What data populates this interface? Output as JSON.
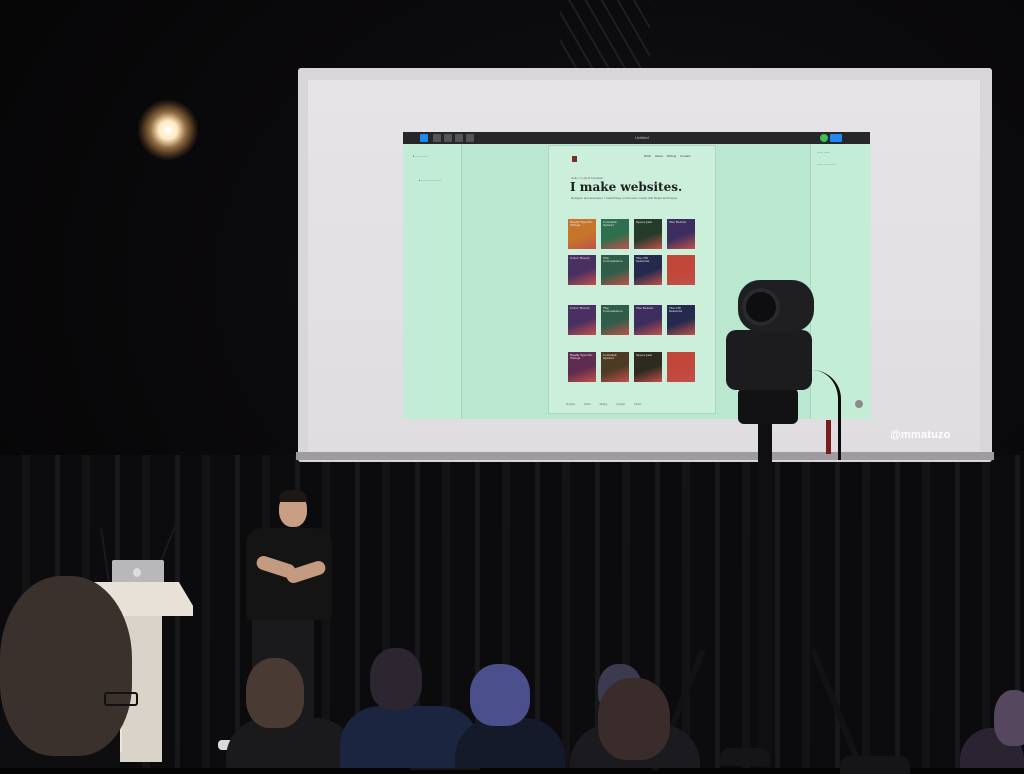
{
  "projected_app": {
    "window_title": "Untitled"
  },
  "projected_site": {
    "eyebrow": "Hello, I'm Emil Kowalski",
    "headline": "I make websites.",
    "intro": "Designer and developer. I build things on the web, mostly with React and Figma.",
    "nav": [
      "Work",
      "About",
      "Writing",
      "Contact"
    ],
    "cards": [
      {
        "title": "Really Specific Things",
        "color": "#c5762c"
      },
      {
        "title": "Constant Sprawl",
        "color": "#2d6f4e"
      },
      {
        "title": "Space Jam",
        "color": "#243b2a"
      },
      {
        "title": "The Return",
        "color": "#3d2d5e"
      },
      {
        "title": "Color Theory",
        "color": "#4a2f63"
      },
      {
        "title": "The Convenience",
        "color": "#2f5d4a"
      },
      {
        "title": "The CW Sessions",
        "color": "#232a4e"
      },
      {
        "title": "",
        "color": "#c0473a"
      },
      {
        "title": "Color Theory",
        "color": "#4a2f63"
      },
      {
        "title": "The Convenience",
        "color": "#2f5d4a"
      },
      {
        "title": "The Return",
        "color": "#3d2d5e"
      },
      {
        "title": "The CW Sessions",
        "color": "#232a4e"
      },
      {
        "title": "Really Specific Things",
        "color": "#5d2c4f"
      },
      {
        "title": "Constant Sprawl",
        "color": "#4e3a24"
      },
      {
        "title": "Space Jam",
        "color": "#2d2a20"
      },
      {
        "title": "",
        "color": "#c0473a"
      }
    ],
    "footer": [
      "Projects",
      "About",
      "Writing",
      "Contact",
      "Twitter"
    ]
  },
  "screen_handle": "@mmatuzo",
  "colors": {
    "screen_canvas": "#b9e7cf",
    "toolbar": "#27272b",
    "toolbar_accent": "#1f8af5"
  }
}
